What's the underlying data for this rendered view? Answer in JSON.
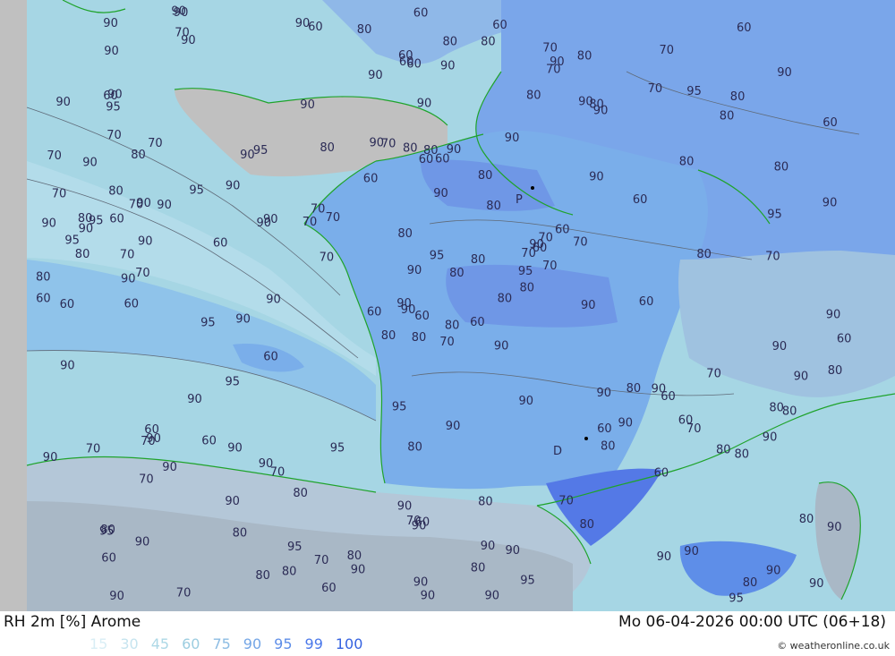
{
  "footer": {
    "title": "RH 2m [%] Arome",
    "datetime": "Mo 06-04-2026 00:00 UTC (06+18)",
    "credit": "© weatheronline.co.uk"
  },
  "legend": {
    "values": [
      "15",
      "30",
      "45",
      "60",
      "75",
      "90",
      "95",
      "99",
      "100"
    ],
    "colors": [
      "#d9eef5",
      "#c6e4ef",
      "#add8e6",
      "#9ccde0",
      "#8cbce3",
      "#74a6e6",
      "#5e8ee8",
      "#4a78ea",
      "#3562e0"
    ]
  },
  "colors": {
    "sea_70": "#a6d6e4",
    "sea_80": "#8fc3ea",
    "sea_90": "#7aaeea",
    "land_humid": "#6f97e6",
    "land_very_humid": "#5479e6",
    "outside_domain": "#c0c0c0",
    "coast": "#1fa32b",
    "contour": "#5f6a78"
  },
  "cities": [
    {
      "name": "Paris",
      "label": "P"
    },
    {
      "name": "Marseille",
      "label": "D"
    }
  ],
  "contour_labels": [
    "70",
    "80",
    "90",
    "80",
    "70",
    "70",
    "80",
    "90",
    "80",
    "80",
    "90",
    "90",
    "70",
    "60",
    "80",
    "90",
    "70",
    "80",
    "80",
    "90",
    "70",
    "60",
    "80",
    "80",
    "60",
    "60",
    "70",
    "60",
    "80",
    "90",
    "90",
    "90",
    "90",
    "90",
    "95",
    "70",
    "90",
    "80",
    "80",
    "90",
    "60",
    "70",
    "60",
    "80",
    "80",
    "90",
    "95",
    "90",
    "90",
    "80",
    "70",
    "80",
    "90",
    "90",
    "80",
    "90",
    "70",
    "90",
    "80",
    "80",
    "80",
    "90",
    "95",
    "90",
    "95",
    "90",
    "90",
    "90",
    "95",
    "90",
    "80",
    "70",
    "80",
    "90",
    "95",
    "90",
    "95",
    "90",
    "80",
    "90",
    "80",
    "90",
    "90",
    "80",
    "90",
    "70",
    "90",
    "90",
    "90",
    "70",
    "60",
    "60",
    "70",
    "60",
    "80",
    "90",
    "90",
    "90",
    "90",
    "90",
    "95",
    "90",
    "90",
    "95",
    "90",
    "90",
    "95",
    "90",
    "80",
    "70",
    "90",
    "95",
    "60",
    "60",
    "60",
    "70",
    "80",
    "90",
    "90",
    "80",
    "70",
    "60",
    "80",
    "80",
    "60",
    "95",
    "90",
    "90",
    "80",
    "70",
    "90",
    "95",
    "90",
    "90",
    "90",
    "70",
    "60",
    "60",
    "80",
    "70",
    "90",
    "90",
    "80",
    "60",
    "70",
    "90",
    "80",
    "90",
    "70",
    "60",
    "95",
    "90",
    "80",
    "60",
    "70",
    "80",
    "90",
    "90",
    "90",
    "90",
    "90",
    "90",
    "60",
    "60",
    "70",
    "80",
    "95",
    "90",
    "90",
    "95",
    "80",
    "90",
    "70",
    "70",
    "60",
    "80",
    "80",
    "60",
    "70",
    "90",
    "90",
    "80",
    "80",
    "60",
    "60",
    "90",
    "70",
    "70",
    "80",
    "60",
    "80",
    "95",
    "60",
    "80",
    "70",
    "60",
    "60",
    "70",
    "60",
    "60",
    "90",
    "70",
    "60",
    "80",
    "60",
    "60"
  ]
}
